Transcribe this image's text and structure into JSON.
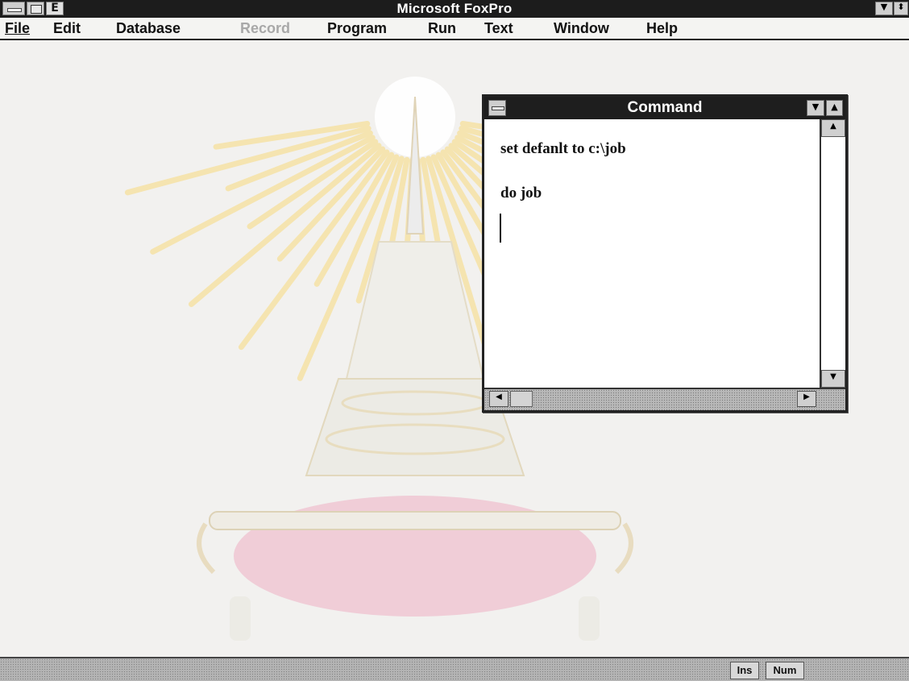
{
  "app": {
    "title": "Microsoft FoxPro"
  },
  "menubar": {
    "items": [
      {
        "label": "File",
        "underline": "F",
        "enabled": true
      },
      {
        "label": "Edit",
        "underline": "E",
        "enabled": true
      },
      {
        "label": "Database",
        "underline": "D",
        "enabled": true
      },
      {
        "label": "Record",
        "underline": "R",
        "enabled": false
      },
      {
        "label": "Program",
        "underline": "P",
        "enabled": true
      },
      {
        "label": "Run",
        "underline": "n",
        "enabled": true
      },
      {
        "label": "Text",
        "underline": "T",
        "enabled": true
      },
      {
        "label": "Window",
        "underline": "W",
        "enabled": true
      },
      {
        "label": "Help",
        "underline": "H",
        "enabled": true
      }
    ]
  },
  "command_window": {
    "title": "Command",
    "lines": [
      "set defanlt to c:\\job",
      "do job"
    ]
  },
  "statusbar": {
    "ins": "Ins",
    "num": "Num"
  },
  "icons": {
    "system_menu": "system-menu-icon",
    "minimize": "minimize-icon",
    "maximize": "maximize-icon",
    "scroll_up": "scroll-up-icon",
    "scroll_down": "scroll-down-icon",
    "scroll_left": "scroll-left-icon",
    "scroll_right": "scroll-right-icon"
  },
  "colors": {
    "titlebar": "#1c1c1c",
    "disabled_menu": "#a8a8a8",
    "emblem_rays": "#f6e2a6",
    "emblem_base": "#f0c9d4"
  }
}
